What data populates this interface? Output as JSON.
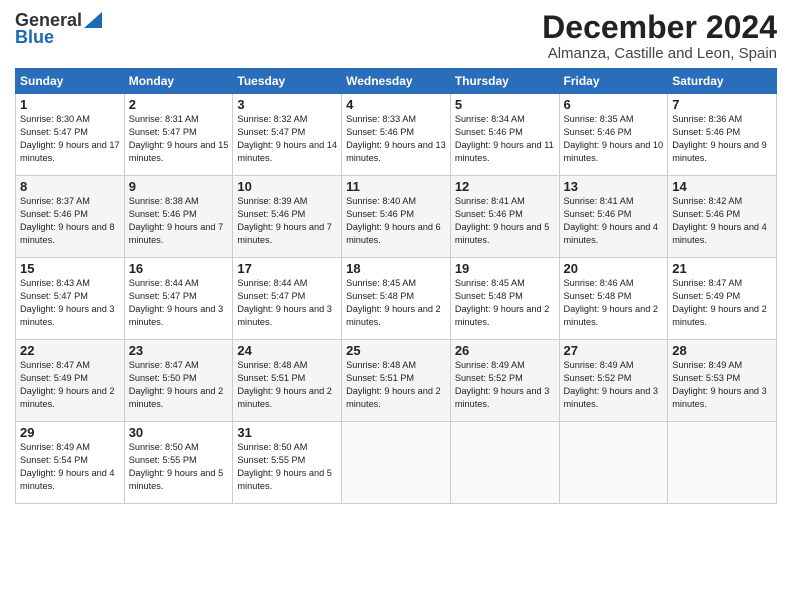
{
  "logo": {
    "general": "General",
    "blue": "Blue"
  },
  "title": "December 2024",
  "location": "Almanza, Castille and Leon, Spain",
  "days_header": [
    "Sunday",
    "Monday",
    "Tuesday",
    "Wednesday",
    "Thursday",
    "Friday",
    "Saturday"
  ],
  "weeks": [
    [
      {
        "day": "1",
        "sunrise": "8:30 AM",
        "sunset": "5:47 PM",
        "daylight": "9 hours and 17 minutes."
      },
      {
        "day": "2",
        "sunrise": "8:31 AM",
        "sunset": "5:47 PM",
        "daylight": "9 hours and 15 minutes."
      },
      {
        "day": "3",
        "sunrise": "8:32 AM",
        "sunset": "5:47 PM",
        "daylight": "9 hours and 14 minutes."
      },
      {
        "day": "4",
        "sunrise": "8:33 AM",
        "sunset": "5:46 PM",
        "daylight": "9 hours and 13 minutes."
      },
      {
        "day": "5",
        "sunrise": "8:34 AM",
        "sunset": "5:46 PM",
        "daylight": "9 hours and 11 minutes."
      },
      {
        "day": "6",
        "sunrise": "8:35 AM",
        "sunset": "5:46 PM",
        "daylight": "9 hours and 10 minutes."
      },
      {
        "day": "7",
        "sunrise": "8:36 AM",
        "sunset": "5:46 PM",
        "daylight": "9 hours and 9 minutes."
      }
    ],
    [
      {
        "day": "8",
        "sunrise": "8:37 AM",
        "sunset": "5:46 PM",
        "daylight": "9 hours and 8 minutes."
      },
      {
        "day": "9",
        "sunrise": "8:38 AM",
        "sunset": "5:46 PM",
        "daylight": "9 hours and 7 minutes."
      },
      {
        "day": "10",
        "sunrise": "8:39 AM",
        "sunset": "5:46 PM",
        "daylight": "9 hours and 7 minutes."
      },
      {
        "day": "11",
        "sunrise": "8:40 AM",
        "sunset": "5:46 PM",
        "daylight": "9 hours and 6 minutes."
      },
      {
        "day": "12",
        "sunrise": "8:41 AM",
        "sunset": "5:46 PM",
        "daylight": "9 hours and 5 minutes."
      },
      {
        "day": "13",
        "sunrise": "8:41 AM",
        "sunset": "5:46 PM",
        "daylight": "9 hours and 4 minutes."
      },
      {
        "day": "14",
        "sunrise": "8:42 AM",
        "sunset": "5:46 PM",
        "daylight": "9 hours and 4 minutes."
      }
    ],
    [
      {
        "day": "15",
        "sunrise": "8:43 AM",
        "sunset": "5:47 PM",
        "daylight": "9 hours and 3 minutes."
      },
      {
        "day": "16",
        "sunrise": "8:44 AM",
        "sunset": "5:47 PM",
        "daylight": "9 hours and 3 minutes."
      },
      {
        "day": "17",
        "sunrise": "8:44 AM",
        "sunset": "5:47 PM",
        "daylight": "9 hours and 3 minutes."
      },
      {
        "day": "18",
        "sunrise": "8:45 AM",
        "sunset": "5:48 PM",
        "daylight": "9 hours and 2 minutes."
      },
      {
        "day": "19",
        "sunrise": "8:45 AM",
        "sunset": "5:48 PM",
        "daylight": "9 hours and 2 minutes."
      },
      {
        "day": "20",
        "sunrise": "8:46 AM",
        "sunset": "5:48 PM",
        "daylight": "9 hours and 2 minutes."
      },
      {
        "day": "21",
        "sunrise": "8:47 AM",
        "sunset": "5:49 PM",
        "daylight": "9 hours and 2 minutes."
      }
    ],
    [
      {
        "day": "22",
        "sunrise": "8:47 AM",
        "sunset": "5:49 PM",
        "daylight": "9 hours and 2 minutes."
      },
      {
        "day": "23",
        "sunrise": "8:47 AM",
        "sunset": "5:50 PM",
        "daylight": "9 hours and 2 minutes."
      },
      {
        "day": "24",
        "sunrise": "8:48 AM",
        "sunset": "5:51 PM",
        "daylight": "9 hours and 2 minutes."
      },
      {
        "day": "25",
        "sunrise": "8:48 AM",
        "sunset": "5:51 PM",
        "daylight": "9 hours and 2 minutes."
      },
      {
        "day": "26",
        "sunrise": "8:49 AM",
        "sunset": "5:52 PM",
        "daylight": "9 hours and 3 minutes."
      },
      {
        "day": "27",
        "sunrise": "8:49 AM",
        "sunset": "5:52 PM",
        "daylight": "9 hours and 3 minutes."
      },
      {
        "day": "28",
        "sunrise": "8:49 AM",
        "sunset": "5:53 PM",
        "daylight": "9 hours and 3 minutes."
      }
    ],
    [
      {
        "day": "29",
        "sunrise": "8:49 AM",
        "sunset": "5:54 PM",
        "daylight": "9 hours and 4 minutes."
      },
      {
        "day": "30",
        "sunrise": "8:50 AM",
        "sunset": "5:55 PM",
        "daylight": "9 hours and 5 minutes."
      },
      {
        "day": "31",
        "sunrise": "8:50 AM",
        "sunset": "5:55 PM",
        "daylight": "9 hours and 5 minutes."
      },
      null,
      null,
      null,
      null
    ]
  ]
}
